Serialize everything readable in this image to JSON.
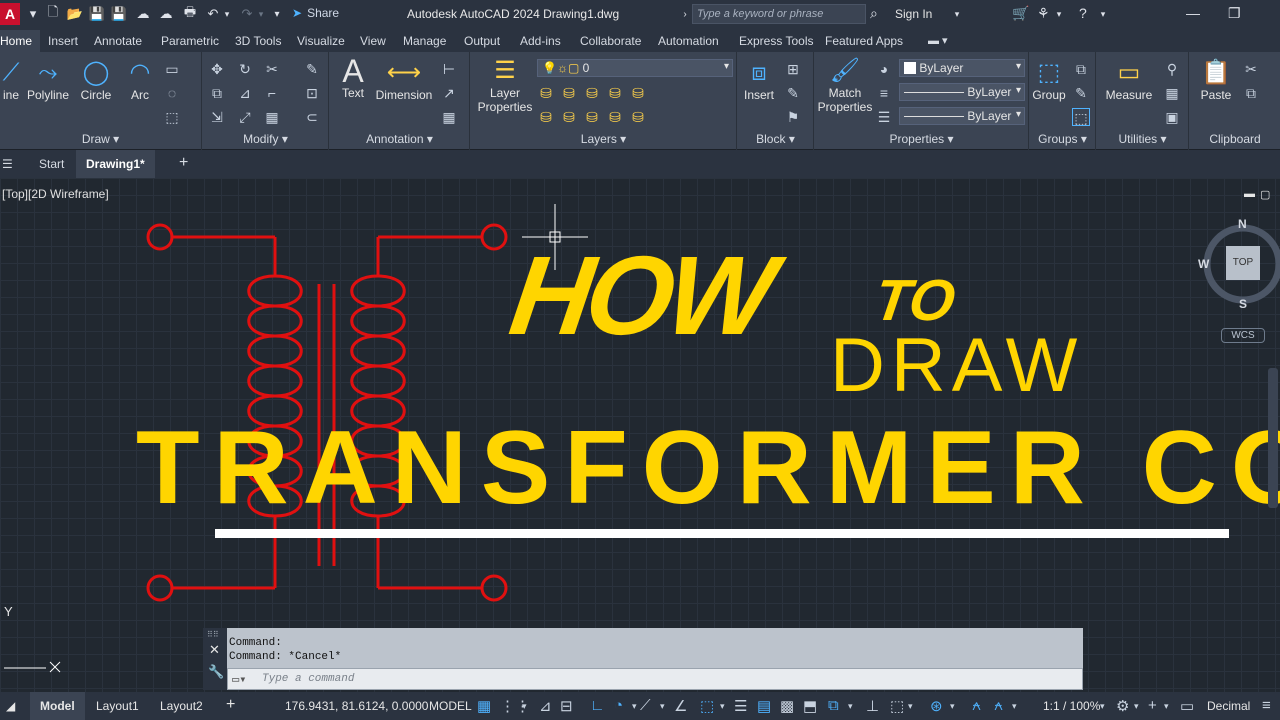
{
  "window": {
    "app_logo": "A",
    "title": "Autodesk AutoCAD 2024    Drawing1.dwg",
    "share_label": "Share",
    "search_placeholder": "Type a keyword or phrase",
    "signin_label": "Sign In"
  },
  "ribbon_tabs": [
    "Home",
    "Insert",
    "Annotate",
    "Parametric",
    "3D Tools",
    "Visualize",
    "View",
    "Manage",
    "Output",
    "Add-ins",
    "Collaborate",
    "Automation",
    "Express Tools",
    "Featured Apps"
  ],
  "ribbon": {
    "draw": {
      "title": "Draw",
      "line": "ine",
      "polyline": "Polyline",
      "circle": "Circle",
      "arc": "Arc"
    },
    "modify": {
      "title": "Modify"
    },
    "annotation": {
      "title": "Annotation",
      "text": "Text",
      "dimension": "Dimension"
    },
    "layers": {
      "title": "Layers",
      "layer_properties_1": "Layer",
      "layer_properties_2": "Properties",
      "current_layer": "0"
    },
    "block": {
      "title": "Block",
      "insert": "Insert"
    },
    "properties": {
      "title": "Properties",
      "match_1": "Match",
      "match_2": "Properties",
      "color": "ByLayer",
      "linetype": "ByLayer",
      "lineweight": "ByLayer"
    },
    "groups": {
      "title": "Groups",
      "group": "Group"
    },
    "utilities": {
      "title": "Utilities",
      "measure": "Measure"
    },
    "clipboard": {
      "title": "Clipboard",
      "paste": "Paste"
    }
  },
  "file_tabs": {
    "start": "Start",
    "current": "Drawing1*"
  },
  "viewport": {
    "label": "[Top][2D Wireframe]",
    "overlay": {
      "how": "HOW",
      "to": "TO",
      "draw": "DRAW",
      "subject": "TRANSFORMER COIL"
    },
    "viewcube": {
      "n": "N",
      "s": "S",
      "w": "W",
      "face": "TOP",
      "wcs": "WCS"
    },
    "axis_y": "Y"
  },
  "command_line": {
    "history": [
      "Command:",
      "Command: *Cancel*"
    ],
    "placeholder": "Type a command"
  },
  "status_bar": {
    "model_tab": "Model",
    "layout1": "Layout1",
    "layout2": "Layout2",
    "coordinates": "176.9431, 81.6124, 0.0000",
    "space": "MODEL",
    "scale": "1:1 / 100%",
    "units": "Decimal"
  },
  "colors": {
    "accent": "#ffd500",
    "drawing_red": "#e01010",
    "background": "#212830"
  }
}
